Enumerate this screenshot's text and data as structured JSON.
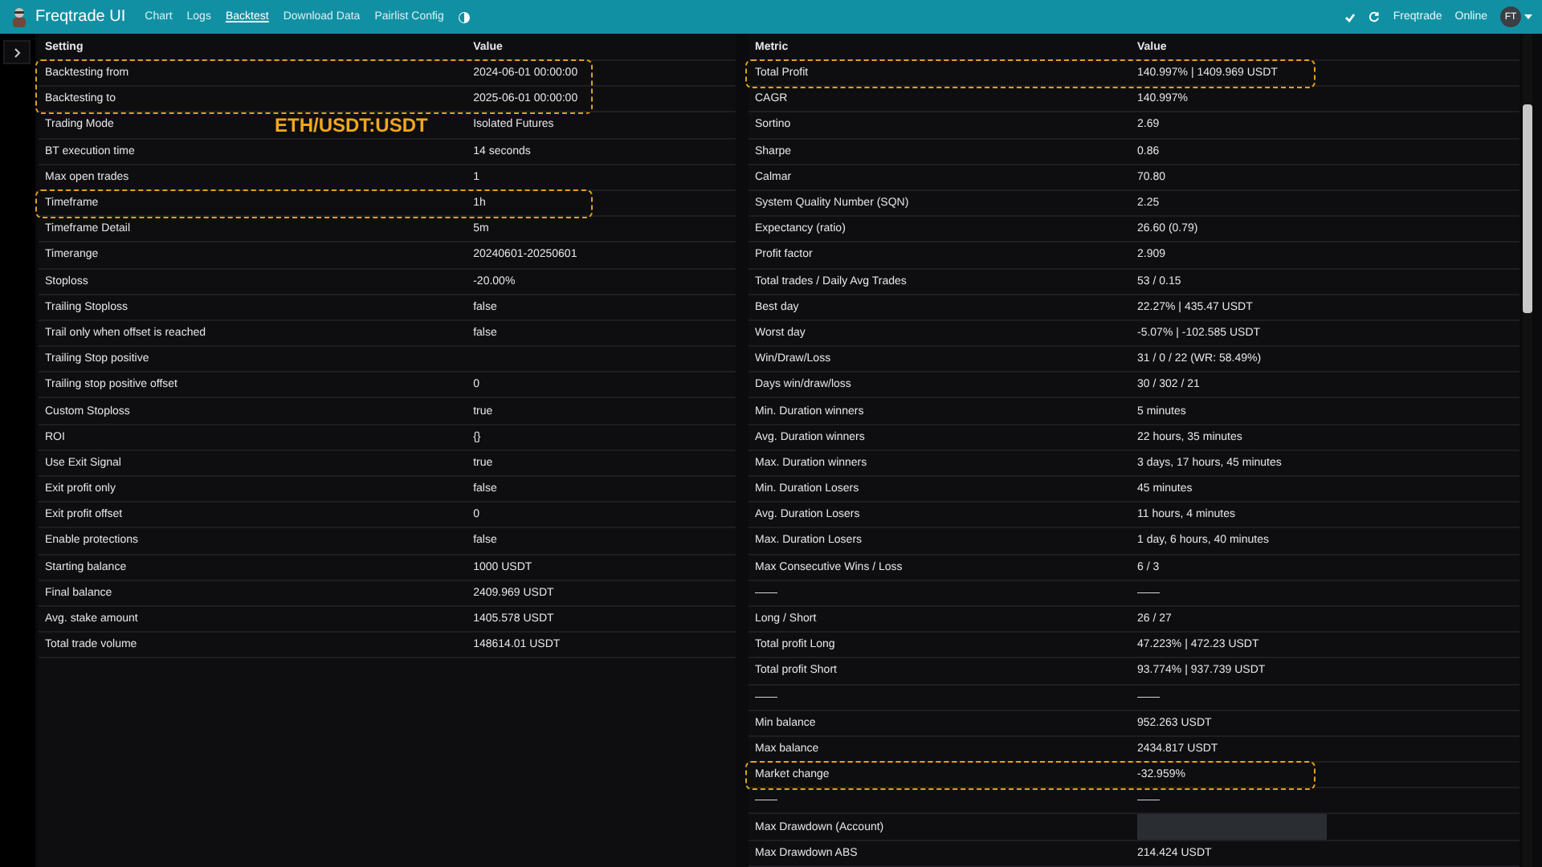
{
  "navbar": {
    "title": "Freqtrade UI",
    "links": [
      {
        "label": "Chart",
        "selected": false
      },
      {
        "label": "Logs",
        "selected": false
      },
      {
        "label": "Backtest",
        "selected": true
      },
      {
        "label": "Download Data",
        "selected": false
      },
      {
        "label": "Pairlist Config",
        "selected": false
      }
    ],
    "bot_name": "Freqtrade",
    "status": "Online",
    "avatar": "FT"
  },
  "settings_table": {
    "columns": [
      "Setting",
      "Value"
    ],
    "annotation": "ETH/USDT:USDT",
    "rows": [
      {
        "setting": "Backtesting from",
        "value": "2024-06-01 00:00:00",
        "highlighted": true
      },
      {
        "setting": "Backtesting to",
        "value": "2025-06-01 00:00:00",
        "highlighted": true
      },
      {
        "setting": "Trading Mode",
        "value": "Isolated Futures",
        "highlighted": false
      },
      {
        "setting": "BT execution time",
        "value": "14 seconds",
        "highlighted": false
      },
      {
        "setting": "Max open trades",
        "value": "1",
        "highlighted": false
      },
      {
        "setting": "Timeframe",
        "value": "1h",
        "highlighted": true
      },
      {
        "setting": "Timeframe Detail",
        "value": "5m",
        "highlighted": false
      },
      {
        "setting": "Timerange",
        "value": "20240601-20250601",
        "highlighted": false
      },
      {
        "setting": "Stoploss",
        "value": "-20.00%",
        "highlighted": false
      },
      {
        "setting": "Trailing Stoploss",
        "value": "false",
        "highlighted": false
      },
      {
        "setting": "Trail only when offset is reached",
        "value": "false",
        "highlighted": false
      },
      {
        "setting": "Trailing Stop positive",
        "highlighted": false
      },
      {
        "setting": "Trailing stop positive offset",
        "value": "0",
        "highlighted": false
      },
      {
        "setting": "Custom Stoploss",
        "value": "true",
        "highlighted": false
      },
      {
        "setting": "ROI",
        "value": "{}",
        "highlighted": false
      },
      {
        "setting": "Use Exit Signal",
        "value": "true",
        "highlighted": false
      },
      {
        "setting": "Exit profit only",
        "value": "false",
        "highlighted": false
      },
      {
        "setting": "Exit profit offset",
        "value": "0",
        "highlighted": false
      },
      {
        "setting": "Enable protections",
        "value": "false",
        "highlighted": false
      },
      {
        "setting": "Starting balance",
        "value": "1000 USDT",
        "highlighted": false
      },
      {
        "setting": "Final balance",
        "value": "2409.969 USDT",
        "highlighted": false
      },
      {
        "setting": "Avg. stake amount",
        "value": "1405.578 USDT",
        "highlighted": false
      },
      {
        "setting": "Total trade volume",
        "value": "148614.01 USDT",
        "highlighted": false
      }
    ]
  },
  "metrics_table": {
    "columns": [
      "Metric",
      "Value"
    ],
    "rows": [
      {
        "setting": "Total Profit",
        "value": "140.997% | 1409.969 USDT",
        "highlighted": true
      },
      {
        "setting": "CAGR",
        "value": "140.997%",
        "highlighted": false
      },
      {
        "setting": "Sortino",
        "value": "2.69",
        "highlighted": false
      },
      {
        "setting": "Sharpe",
        "value": "0.86",
        "highlighted": false
      },
      {
        "setting": "Calmar",
        "value": "70.80",
        "highlighted": false
      },
      {
        "setting": "System Quality Number (SQN)",
        "value": "2.25",
        "highlighted": false
      },
      {
        "setting": "Expectancy (ratio)",
        "value": "26.60 (0.79)",
        "highlighted": false
      },
      {
        "setting": "Profit factor",
        "value": "2.909",
        "highlighted": false
      },
      {
        "setting": "Total trades / Daily Avg Trades",
        "value": "53 / 0.15",
        "highlighted": false
      },
      {
        "setting": "Best day",
        "value": "22.27% | 435.47 USDT",
        "highlighted": false
      },
      {
        "setting": "Worst day",
        "value": "-5.07% | -102.585 USDT",
        "highlighted": false
      },
      {
        "setting": "Win/Draw/Loss",
        "value": "31 / 0 / 22 (WR: 58.49%)",
        "highlighted": false
      },
      {
        "setting": "Days win/draw/loss",
        "value": "30 / 302 / 21",
        "highlighted": false
      },
      {
        "setting": "Min. Duration winners",
        "value": "5 minutes",
        "highlighted": false
      },
      {
        "setting": "Avg. Duration winners",
        "value": "22 hours, 35 minutes",
        "highlighted": false
      },
      {
        "setting": "Max. Duration winners",
        "value": "3 days, 17 hours, 45 minutes",
        "highlighted": false
      },
      {
        "setting": "Min. Duration Losers",
        "value": "45 minutes",
        "highlighted": false
      },
      {
        "setting": "Avg. Duration Losers",
        "value": "11 hours, 4 minutes",
        "highlighted": false
      },
      {
        "setting": "Max. Duration Losers",
        "value": "1 day, 6 hours, 40 minutes",
        "highlighted": false
      },
      {
        "setting": "Max Consecutive Wins / Loss",
        "value": "6 / 3",
        "highlighted": false
      },
      {
        "setting": "——",
        "value": "——",
        "highlighted": false
      },
      {
        "setting": "Long / Short",
        "value": "26 / 27",
        "highlighted": false
      },
      {
        "setting": "Total profit Long",
        "value": "47.223% | 472.23 USDT",
        "highlighted": false
      },
      {
        "setting": "Total profit Short",
        "value": "93.774% | 937.739 USDT",
        "highlighted": false
      },
      {
        "setting": "——",
        "value": "——",
        "highlighted": false
      },
      {
        "setting": "Min balance",
        "value": "952.263 USDT",
        "highlighted": false
      },
      {
        "setting": "Max balance",
        "value": "2434.817 USDT",
        "highlighted": false
      },
      {
        "setting": "Market change",
        "value": "-32.959%",
        "highlighted": true
      },
      {
        "setting": "——",
        "value": "——",
        "highlighted": false
      },
      {
        "setting": "Max Drawdown (Account)",
        "masked": true,
        "highlighted": false
      },
      {
        "setting": "Max Drawdown ABS",
        "value": "214.424 USDT",
        "highlighted": false
      }
    ]
  }
}
